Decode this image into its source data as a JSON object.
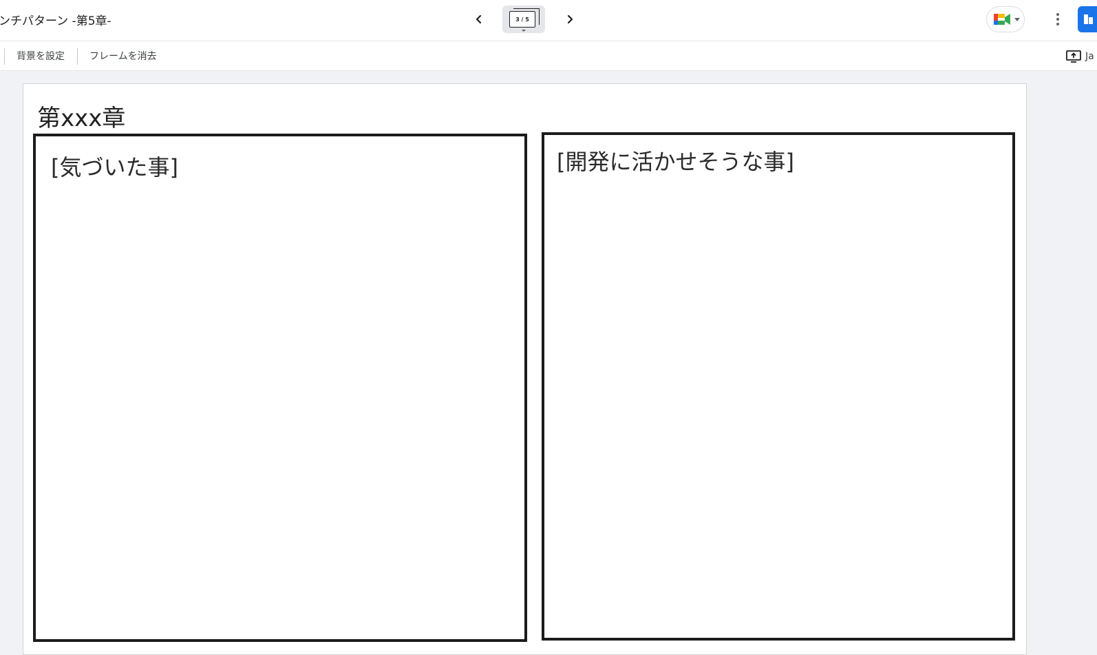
{
  "header": {
    "doc_title": "ンチパターン -第5章-",
    "slide_counter": "3 / 5",
    "prev_icon": "chevron-left-icon",
    "next_icon": "chevron-right-icon",
    "meet_icon": "google-meet-icon",
    "more_icon": "more-vert-icon",
    "accent_color": "#1a73e8"
  },
  "toolbar": {
    "set_background_label": "背景を設定",
    "clear_frame_label": "フレームを消去",
    "present_label": "Ja"
  },
  "slide": {
    "title": "第xxx章",
    "left_panel_label": "[気づいた事]",
    "right_panel_label": "[開発に活かせそうな事]"
  }
}
